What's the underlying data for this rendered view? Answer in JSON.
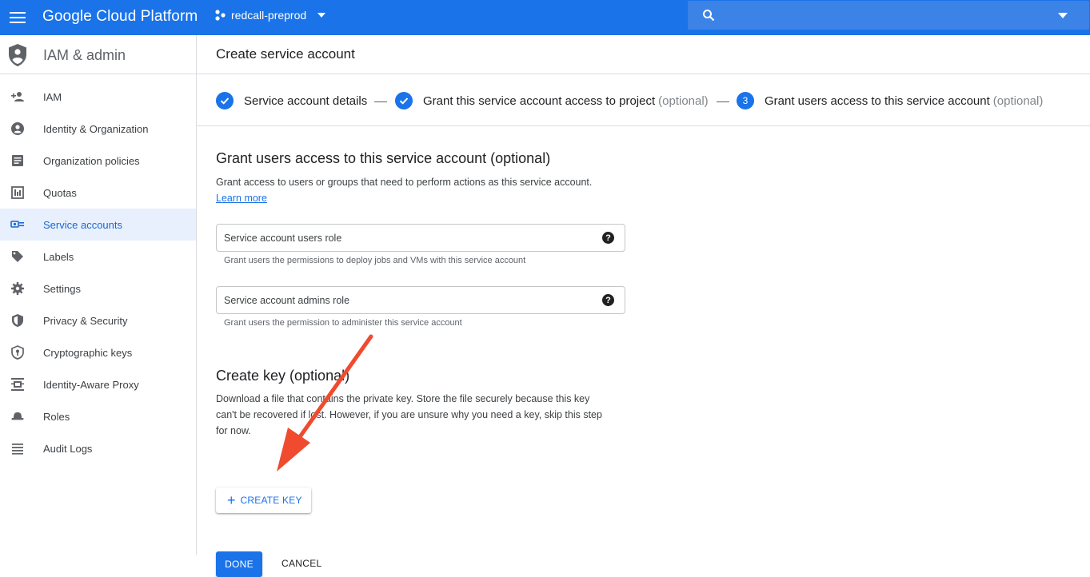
{
  "topbar": {
    "brand": "Google Cloud Platform",
    "project": "redcall-preprod",
    "search_placeholder": ""
  },
  "sidebar": {
    "title": "IAM & admin",
    "items": [
      {
        "label": "IAM",
        "icon": "person-add-icon"
      },
      {
        "label": "Identity & Organization",
        "icon": "account-circle-icon"
      },
      {
        "label": "Organization policies",
        "icon": "policy-doc-icon"
      },
      {
        "label": "Quotas",
        "icon": "quotas-icon"
      },
      {
        "label": "Service accounts",
        "icon": "service-account-icon",
        "active": true
      },
      {
        "label": "Labels",
        "icon": "label-tag-icon"
      },
      {
        "label": "Settings",
        "icon": "gear-icon"
      },
      {
        "label": "Privacy & Security",
        "icon": "shield-icon"
      },
      {
        "label": "Cryptographic keys",
        "icon": "key-shield-icon"
      },
      {
        "label": "Identity-Aware Proxy",
        "icon": "proxy-icon"
      },
      {
        "label": "Roles",
        "icon": "hat-icon"
      },
      {
        "label": "Audit Logs",
        "icon": "list-icon"
      }
    ]
  },
  "page": {
    "title": "Create service account"
  },
  "stepper": {
    "steps": [
      {
        "label": "Service account details",
        "optional": "",
        "state": "done"
      },
      {
        "label": "Grant this service account access to project",
        "optional": "(optional)",
        "state": "done"
      },
      {
        "label": "Grant users access to this service account",
        "optional": "(optional)",
        "state": "current",
        "number": "3"
      }
    ]
  },
  "grant": {
    "heading": "Grant users access to this service account (optional)",
    "description": "Grant access to users or groups that need to perform actions as this service account.",
    "learn_more": "Learn more",
    "users_role_placeholder": "Service account users role",
    "users_role_hint": "Grant users the permissions to deploy jobs and VMs with this service account",
    "admins_role_placeholder": "Service account admins role",
    "admins_role_hint": "Grant users the permission to administer this service account"
  },
  "create_key": {
    "heading": "Create key (optional)",
    "description_1": "Download a file that contains the private key. Store the file securely because this key",
    "description_2": "can't be recovered if lost. However, if you are unsure why you need a key, skip this step",
    "description_3": "for now.",
    "button": "CREATE KEY"
  },
  "actions": {
    "done": "DONE",
    "cancel": "CANCEL"
  },
  "colors": {
    "accent": "#1a73e8",
    "annotation_arrow": "#f04a2f"
  }
}
